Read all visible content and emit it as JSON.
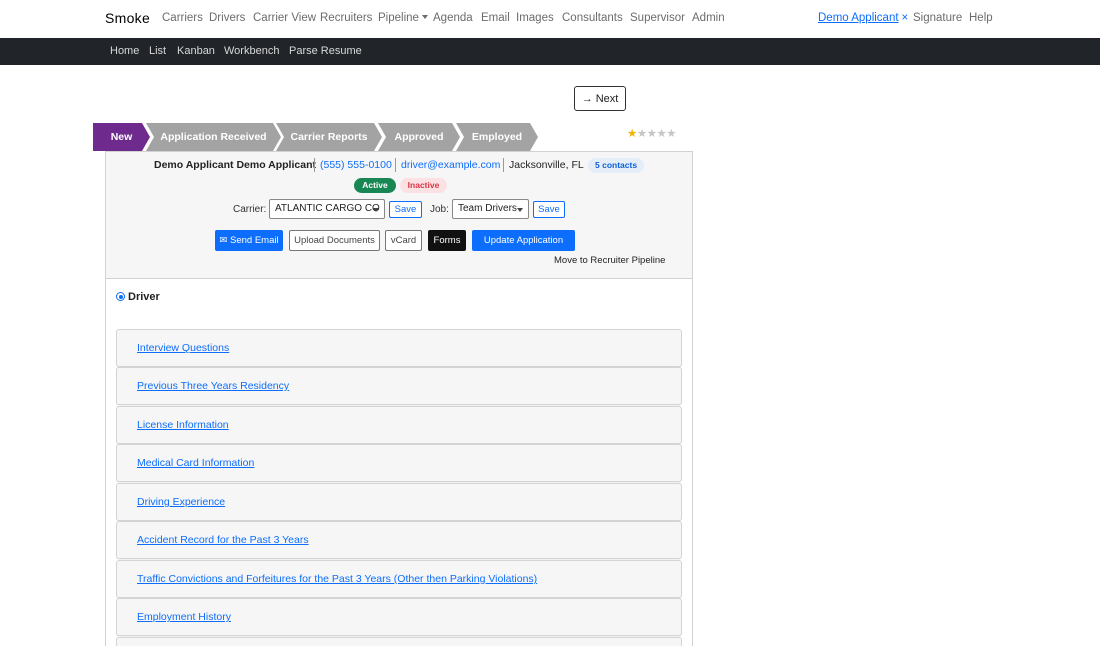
{
  "topnav": {
    "brand": "Smoke",
    "links": [
      "Carriers",
      "Drivers",
      "Carrier View",
      "Recruiters",
      "Pipeline",
      "Agenda",
      "Email",
      "Images",
      "Consultants",
      "Supervisor",
      "Admin"
    ],
    "user": "Demo Applicant",
    "user_close": "×",
    "right_links": [
      "Signature",
      "Help"
    ]
  },
  "subnav": {
    "links": [
      "Home",
      "List",
      "Kanban",
      "Workbench",
      "Parse Resume"
    ]
  },
  "next_button": {
    "icon": "→",
    "label": "Next"
  },
  "stages": [
    "New",
    "Application Received",
    "Carrier Reports",
    "Approved",
    "Employed"
  ],
  "colors": {
    "current_stage": "#6f2a8e",
    "stage": "#a3a3a3",
    "primary": "#0d6efd",
    "active": "#198754",
    "inactive": "#dc3545",
    "star": "#f0b400"
  },
  "rating": {
    "value": 1,
    "max": 5,
    "star_glyph": "★"
  },
  "applicant": {
    "name": "Demo Applicant Demo Applicant",
    "phone": "(555) 555-0100",
    "email": "driver@example.com",
    "location": "Jacksonville, FL",
    "contacts": "5 contacts"
  },
  "status": {
    "active": "Active",
    "inactive": "Inactive"
  },
  "carrier": {
    "label": "Carrier:",
    "value": "ATLANTIC CARGO CO",
    "save": "Save"
  },
  "job": {
    "label": "Job:",
    "value": "Team Drivers",
    "save": "Save"
  },
  "actions": {
    "send_email_icon": "✉",
    "send_email": "Send Email",
    "upload": "Upload Documents",
    "vcard": "vCard",
    "forms": "Forms",
    "update": "Update Application",
    "move": "Move to Recruiter Pipeline"
  },
  "role": {
    "label": "Driver"
  },
  "sections": [
    "Interview Questions",
    "Previous Three Years Residency",
    "License Information",
    "Medical Card Information",
    "Driving Experience",
    "Accident Record for the Past 3 Years",
    "Traffic Convictions and Forfeitures for the Past 3 Years (Other then Parking Violations)",
    "Employment History"
  ]
}
